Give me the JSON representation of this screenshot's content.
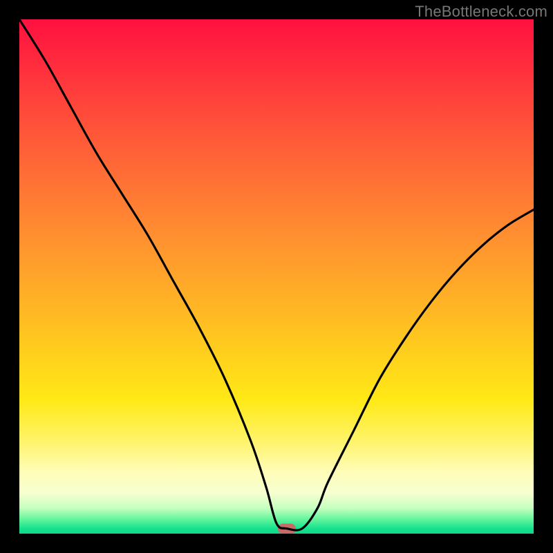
{
  "watermark": "TheBottleneck.com",
  "colors": {
    "background": "#000000",
    "curve": "#000000",
    "marker": "#c76b67"
  },
  "chart_data": {
    "type": "line",
    "title": "",
    "xlabel": "",
    "ylabel": "",
    "xlim": [
      0,
      100
    ],
    "ylim": [
      0,
      100
    ],
    "grid": false,
    "legend": false,
    "series": [
      {
        "name": "bottleneck-curve",
        "x": [
          0,
          5,
          10,
          15,
          20,
          25,
          30,
          35,
          40,
          45,
          48,
          50,
          52,
          55,
          58,
          60,
          65,
          70,
          75,
          80,
          85,
          90,
          95,
          100
        ],
        "values": [
          100,
          92,
          83,
          74,
          66,
          58,
          49,
          40,
          30,
          18,
          9,
          2,
          1,
          1,
          5,
          10,
          20,
          30,
          38,
          45,
          51,
          56,
          60,
          63
        ]
      }
    ],
    "annotations": [
      {
        "name": "optimal-marker",
        "x": 52,
        "y": 1,
        "shape": "rounded-rect"
      }
    ],
    "background_gradient": {
      "orientation": "vertical",
      "stops": [
        {
          "pos": 0.0,
          "color": "#ff1040"
        },
        {
          "pos": 0.5,
          "color": "#ffb026"
        },
        {
          "pos": 0.82,
          "color": "#fff46a"
        },
        {
          "pos": 1.0,
          "color": "#0fd788"
        }
      ]
    }
  }
}
